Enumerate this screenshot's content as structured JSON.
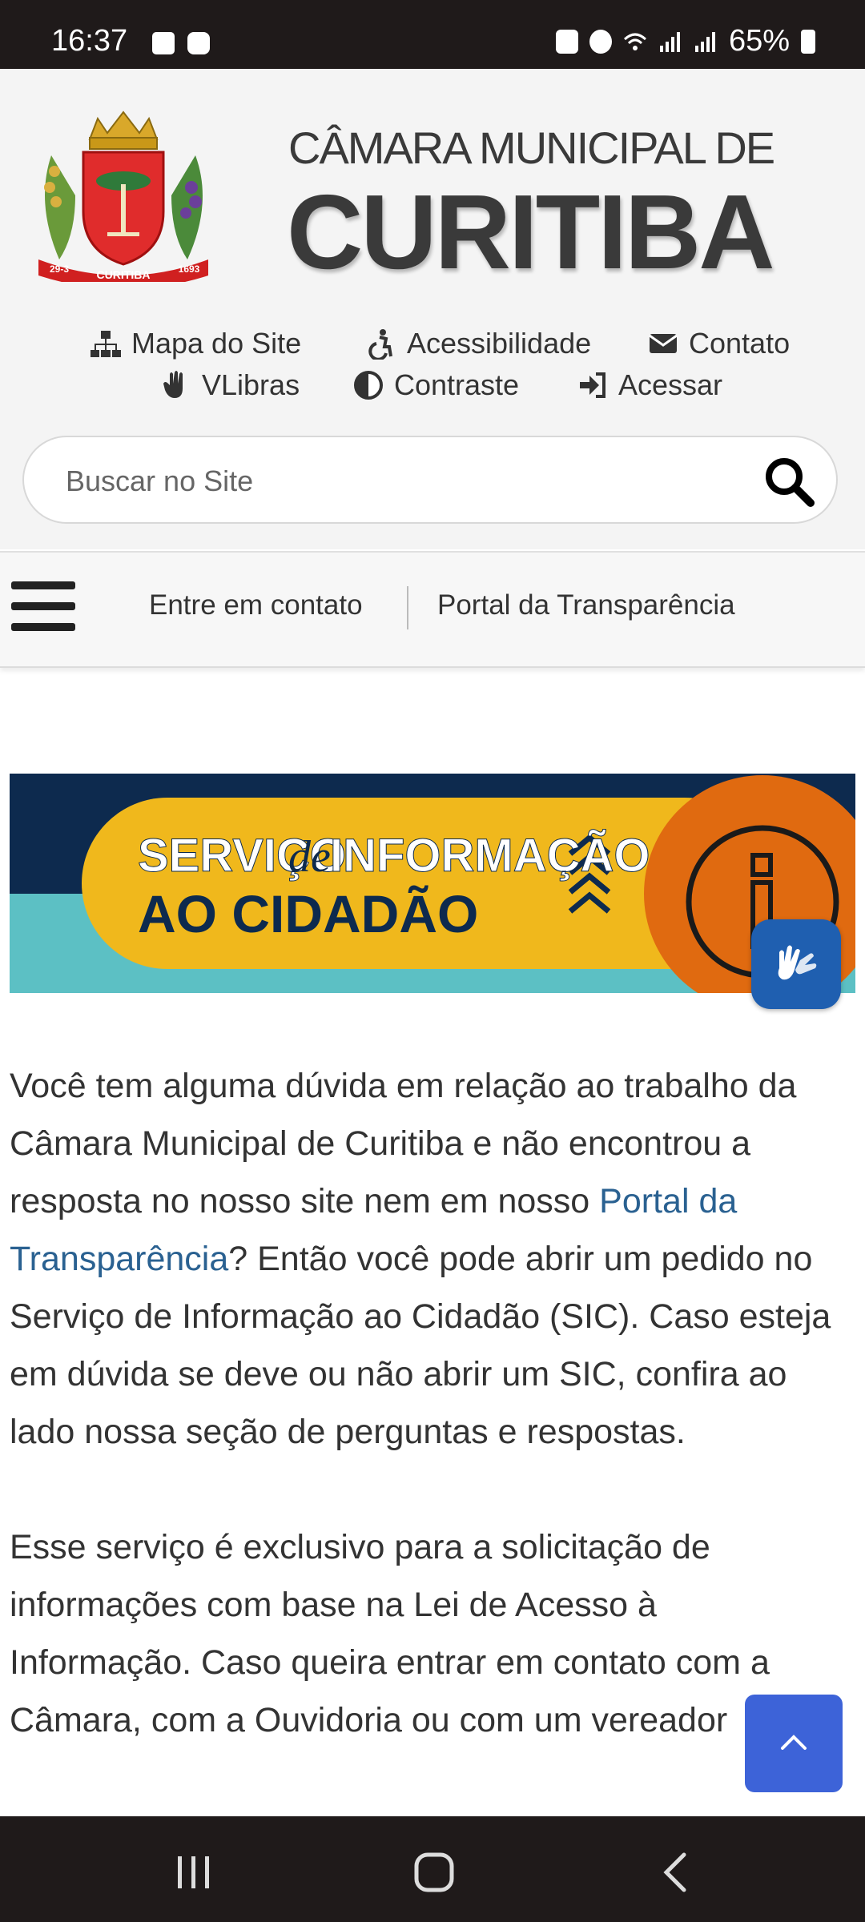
{
  "status_bar": {
    "time": "16:37",
    "battery": "65%",
    "icons": [
      "gallery-icon",
      "screen-record-icon",
      "battery-saver-icon",
      "alarm-icon",
      "wifi-icon",
      "signal-icon",
      "signal-icon",
      "battery-icon"
    ]
  },
  "header": {
    "title_small": "CÂMARA MUNICIPAL DE",
    "title_big": "CURITIBA",
    "emblem_text": "CURITIBA",
    "emblem_years": [
      "29-3",
      "1693"
    ]
  },
  "utility_links": [
    {
      "label": "Mapa do Site",
      "icon": "sitemap-icon"
    },
    {
      "label": "Acessibilidade",
      "icon": "accessibility-icon"
    },
    {
      "label": "Contato",
      "icon": "envelope-icon"
    },
    {
      "label": "VLibras",
      "icon": "hand-icon"
    },
    {
      "label": "Contraste",
      "icon": "contrast-icon"
    },
    {
      "label": "Acessar",
      "icon": "sign-in-icon"
    }
  ],
  "search": {
    "placeholder": "Buscar no Site"
  },
  "nav": {
    "link1": "Entre em contato",
    "link2": "Portal da Transparência"
  },
  "banner": {
    "line1a": "SERVIÇO",
    "line1b": "de",
    "line1c": "INFORMAÇÃO",
    "line2": "AO CIDADÃO"
  },
  "content": {
    "p1_before": "Você tem alguma dúvida em relação ao trabalho da Câmara Municipal de Curitiba e não encontrou a resposta no nosso site nem em nosso ",
    "p1_link": "Portal da Transparência",
    "p1_after": "? Então você pode abrir um pedido no Serviço de Informação ao Cidadão (SIC). Caso esteja em dúvida se deve ou não abrir um SIC, confira ao lado nossa seção de perguntas e respostas.",
    "p2": "Esse serviço é exclusivo para a solicitação de informações com base na Lei de Acesso à Informação. Caso queira entrar em contato com a Câmara, com a Ouvidoria ou com um vereador"
  },
  "colors": {
    "link": "#2a6191",
    "banner_navy": "#0d2a4e",
    "banner_teal": "#5cc0c4",
    "banner_yellow": "#f0b81c",
    "banner_orange": "#e06a10",
    "vlibras_blue": "#1f5fb0",
    "scroll_top_blue": "#3d63d8"
  }
}
